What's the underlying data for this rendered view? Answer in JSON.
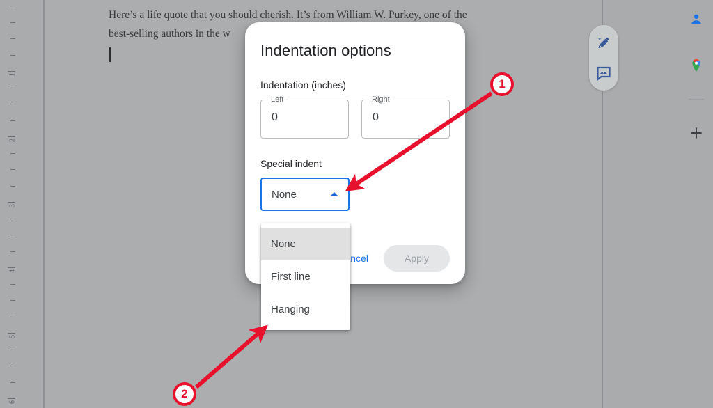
{
  "document": {
    "lines": [
      "Here’s a life quote that you should cherish. It’s from William W. Purkey, one of the",
      "best-selling authors in the w"
    ],
    "ruler_numbers": [
      "1",
      "2",
      "3",
      "4",
      "5",
      "6"
    ]
  },
  "side_pill": {
    "icons": [
      {
        "name": "magic-pencil-icon",
        "title": "Editing mode"
      },
      {
        "name": "comment-image-icon",
        "title": "Insert comment"
      }
    ]
  },
  "rail": {
    "icons": [
      {
        "name": "contacts-person-icon",
        "title": "Contacts"
      },
      {
        "name": "google-maps-pin-icon",
        "title": "Google Maps"
      },
      {
        "name": "add-plus-icon",
        "title": "Get add-ons"
      }
    ]
  },
  "dialog": {
    "title": "Indentation options",
    "indentation_label": "Indentation (inches)",
    "fields": [
      {
        "label": "Left",
        "value": "0"
      },
      {
        "label": "Right",
        "value": "0"
      }
    ],
    "special_indent_label": "Special indent",
    "select": {
      "value": "None",
      "arrow_icon": "chevron-up-icon",
      "expanded": true,
      "options": [
        {
          "label": "None",
          "selected": true
        },
        {
          "label": "First line",
          "selected": false
        },
        {
          "label": "Hanging",
          "selected": false
        }
      ]
    },
    "cancel_label": "Cancel",
    "apply_label": "Apply"
  },
  "annotations": [
    {
      "number": "1"
    },
    {
      "number": "2"
    }
  ],
  "colors": {
    "accent_blue": "#1a73e8",
    "annotation_red": "#e8112d",
    "dim_overlay": "#a9abad",
    "selected_option": "#e0e0e0"
  }
}
